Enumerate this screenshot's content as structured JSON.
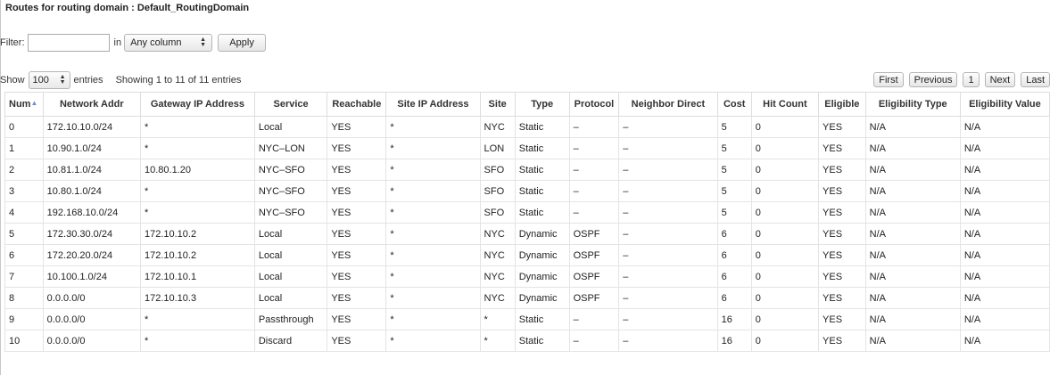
{
  "title": "Routes for routing domain : Default_RoutingDomain",
  "filter": {
    "label": "Filter:",
    "value": "",
    "in_label": "in",
    "column_select": "Any column",
    "apply_label": "Apply"
  },
  "length": {
    "show_label": "Show",
    "value": "100",
    "entries_label": "entries",
    "info": "Showing 1 to 11 of 11 entries"
  },
  "pager": {
    "first": "First",
    "previous": "Previous",
    "page": "1",
    "next": "Next",
    "last": "Last"
  },
  "table": {
    "columns": [
      "Num",
      "Network Addr",
      "Gateway IP Address",
      "Service",
      "Reachable",
      "Site IP Address",
      "Site",
      "Type",
      "Protocol",
      "Neighbor Direct",
      "Cost",
      "Hit Count",
      "Eligible",
      "Eligibility Type",
      "Eligibility Value"
    ],
    "rows": [
      [
        "0",
        "172.10.10.0/24",
        "*",
        "Local",
        "YES",
        "*",
        "NYC",
        "Static",
        "–",
        "–",
        "5",
        "0",
        "YES",
        "N/A",
        "N/A"
      ],
      [
        "1",
        "10.90.1.0/24",
        "*",
        "NYC–LON",
        "YES",
        "*",
        "LON",
        "Static",
        "–",
        "–",
        "5",
        "0",
        "YES",
        "N/A",
        "N/A"
      ],
      [
        "2",
        "10.81.1.0/24",
        "10.80.1.20",
        "NYC–SFO",
        "YES",
        "*",
        "SFO",
        "Static",
        "–",
        "–",
        "5",
        "0",
        "YES",
        "N/A",
        "N/A"
      ],
      [
        "3",
        "10.80.1.0/24",
        "*",
        "NYC–SFO",
        "YES",
        "*",
        "SFO",
        "Static",
        "–",
        "–",
        "5",
        "0",
        "YES",
        "N/A",
        "N/A"
      ],
      [
        "4",
        "192.168.10.0/24",
        "*",
        "NYC–SFO",
        "YES",
        "*",
        "SFO",
        "Static",
        "–",
        "–",
        "5",
        "0",
        "YES",
        "N/A",
        "N/A"
      ],
      [
        "5",
        "172.30.30.0/24",
        "172.10.10.2",
        "Local",
        "YES",
        "*",
        "NYC",
        "Dynamic",
        "OSPF",
        "–",
        "6",
        "0",
        "YES",
        "N/A",
        "N/A"
      ],
      [
        "6",
        "172.20.20.0/24",
        "172.10.10.2",
        "Local",
        "YES",
        "*",
        "NYC",
        "Dynamic",
        "OSPF",
        "–",
        "6",
        "0",
        "YES",
        "N/A",
        "N/A"
      ],
      [
        "7",
        "10.100.1.0/24",
        "172.10.10.1",
        "Local",
        "YES",
        "*",
        "NYC",
        "Dynamic",
        "OSPF",
        "–",
        "6",
        "0",
        "YES",
        "N/A",
        "N/A"
      ],
      [
        "8",
        "0.0.0.0/0",
        "172.10.10.3",
        "Local",
        "YES",
        "*",
        "NYC",
        "Dynamic",
        "OSPF",
        "–",
        "6",
        "0",
        "YES",
        "N/A",
        "N/A"
      ],
      [
        "9",
        "0.0.0.0/0",
        "*",
        "Passthrough",
        "YES",
        "*",
        "*",
        "Static",
        "–",
        "–",
        "16",
        "0",
        "YES",
        "N/A",
        "N/A"
      ],
      [
        "10",
        "0.0.0.0/0",
        "*",
        "Discard",
        "YES",
        "*",
        "*",
        "Static",
        "–",
        "–",
        "16",
        "0",
        "YES",
        "N/A",
        "N/A"
      ]
    ]
  }
}
